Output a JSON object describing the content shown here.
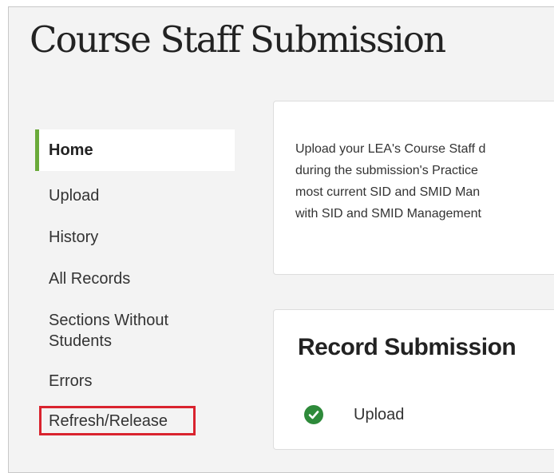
{
  "page": {
    "title": "Course Staff Submission"
  },
  "sidebar": {
    "items": [
      {
        "label": "Home",
        "active": true
      },
      {
        "label": "Upload"
      },
      {
        "label": "History"
      },
      {
        "label": "All Records"
      },
      {
        "label": "Sections Without"
      },
      {
        "label": "Students"
      },
      {
        "label": "Errors"
      },
      {
        "label": "Refresh/Release",
        "highlighted": true
      }
    ]
  },
  "intro": {
    "lines": [
      "Upload your LEA's Course Staff d",
      "during the submission's Practice",
      "most current SID and SMID Man",
      "with SID and SMID Management"
    ]
  },
  "record_submission": {
    "title": "Record Submission",
    "steps": [
      {
        "label": "Upload",
        "icon": "check-circle-icon",
        "status": "complete"
      }
    ]
  },
  "colors": {
    "active_accent": "#6aaa3a",
    "highlight_border": "#d9232e",
    "check_green": "#2e8a3a"
  }
}
